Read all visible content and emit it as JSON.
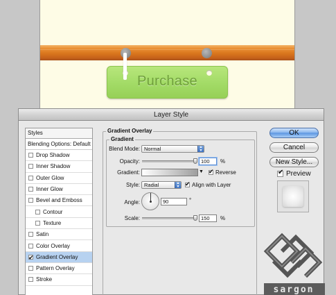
{
  "canvas": {
    "button_label": "Purchase",
    "background_color": "#fefce6",
    "wood_color": "#e08428",
    "tag_color": "#a4dc68"
  },
  "dialog": {
    "title": "Layer Style",
    "styles_list": {
      "header": "Styles",
      "blending_options": "Blending Options: Default",
      "items": [
        {
          "label": "Drop Shadow",
          "checked": false,
          "indent": false,
          "selected": false
        },
        {
          "label": "Inner Shadow",
          "checked": false,
          "indent": false,
          "selected": false
        },
        {
          "label": "Outer Glow",
          "checked": false,
          "indent": false,
          "selected": false
        },
        {
          "label": "Inner Glow",
          "checked": false,
          "indent": false,
          "selected": false
        },
        {
          "label": "Bevel and Emboss",
          "checked": false,
          "indent": false,
          "selected": false
        },
        {
          "label": "Contour",
          "checked": false,
          "indent": true,
          "selected": false
        },
        {
          "label": "Texture",
          "checked": false,
          "indent": true,
          "selected": false
        },
        {
          "label": "Satin",
          "checked": false,
          "indent": false,
          "selected": false
        },
        {
          "label": "Color Overlay",
          "checked": false,
          "indent": false,
          "selected": false
        },
        {
          "label": "Gradient Overlay",
          "checked": true,
          "indent": false,
          "selected": true
        },
        {
          "label": "Pattern Overlay",
          "checked": false,
          "indent": false,
          "selected": false
        },
        {
          "label": "Stroke",
          "checked": false,
          "indent": false,
          "selected": false
        }
      ]
    },
    "panel": {
      "section_title": "Gradient Overlay",
      "group_title": "Gradient",
      "blend_mode_label": "Blend Mode:",
      "blend_mode_value": "Normal",
      "opacity_label": "Opacity:",
      "opacity_value": "100",
      "opacity_unit": "%",
      "opacity_fraction": 1.0,
      "gradient_label": "Gradient:",
      "reverse_label": "Reverse",
      "reverse_checked": true,
      "style_label": "Style:",
      "style_value": "Radial",
      "align_label": "Align with Layer",
      "align_checked": true,
      "angle_label": "Angle:",
      "angle_value": "90",
      "angle_unit": "°",
      "scale_label": "Scale:",
      "scale_value": "150",
      "scale_unit": "%",
      "scale_fraction": 1.0
    },
    "buttons": {
      "ok": "OK",
      "cancel": "Cancel",
      "new_style": "New Style...",
      "preview_label": "Preview",
      "preview_checked": true
    },
    "watermark": "sargon"
  }
}
